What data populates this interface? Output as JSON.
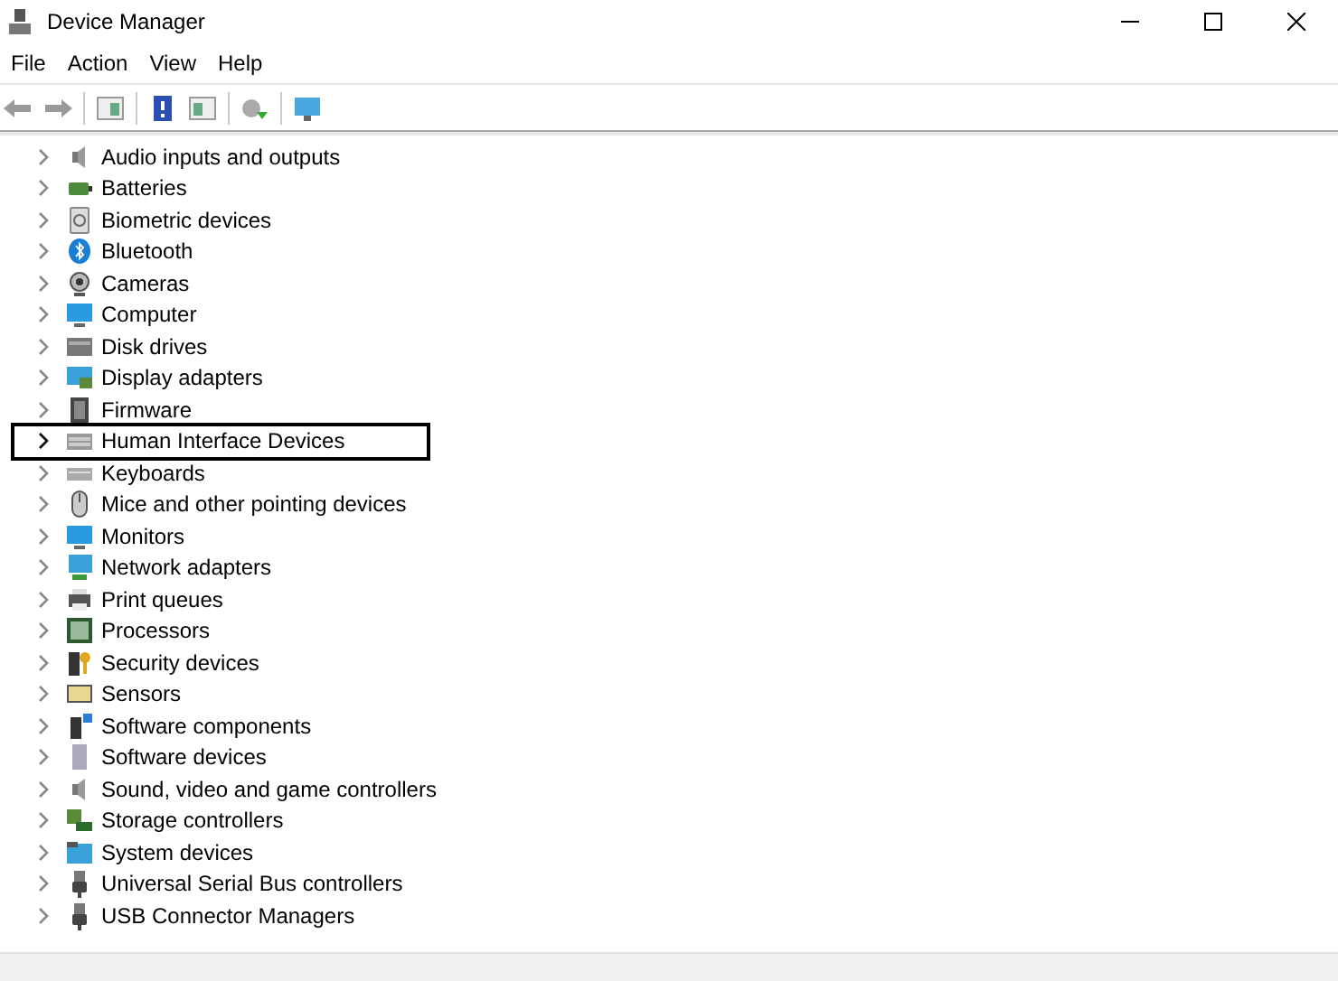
{
  "window": {
    "title": "Device Manager"
  },
  "menu": [
    "File",
    "Action",
    "View",
    "Help"
  ],
  "tree": [
    {
      "label": "Audio inputs and outputs",
      "outlined": false
    },
    {
      "label": "Batteries",
      "outlined": false
    },
    {
      "label": "Biometric devices",
      "outlined": false
    },
    {
      "label": "Bluetooth",
      "outlined": false
    },
    {
      "label": "Cameras",
      "outlined": false
    },
    {
      "label": "Computer",
      "outlined": false
    },
    {
      "label": "Disk drives",
      "outlined": false
    },
    {
      "label": "Display adapters",
      "outlined": false
    },
    {
      "label": "Firmware",
      "outlined": false
    },
    {
      "label": "Human Interface Devices",
      "outlined": true
    },
    {
      "label": "Keyboards",
      "outlined": false
    },
    {
      "label": "Mice and other pointing devices",
      "outlined": false
    },
    {
      "label": "Monitors",
      "outlined": false
    },
    {
      "label": "Network adapters",
      "outlined": false
    },
    {
      "label": "Print queues",
      "outlined": false
    },
    {
      "label": "Processors",
      "outlined": false
    },
    {
      "label": "Security devices",
      "outlined": false
    },
    {
      "label": "Sensors",
      "outlined": false
    },
    {
      "label": "Software components",
      "outlined": false
    },
    {
      "label": "Software devices",
      "outlined": false
    },
    {
      "label": "Sound, video and game controllers",
      "outlined": false
    },
    {
      "label": "Storage controllers",
      "outlined": false
    },
    {
      "label": "System devices",
      "outlined": false
    },
    {
      "label": "Universal Serial Bus controllers",
      "outlined": false
    },
    {
      "label": "USB Connector Managers",
      "outlined": false
    }
  ]
}
